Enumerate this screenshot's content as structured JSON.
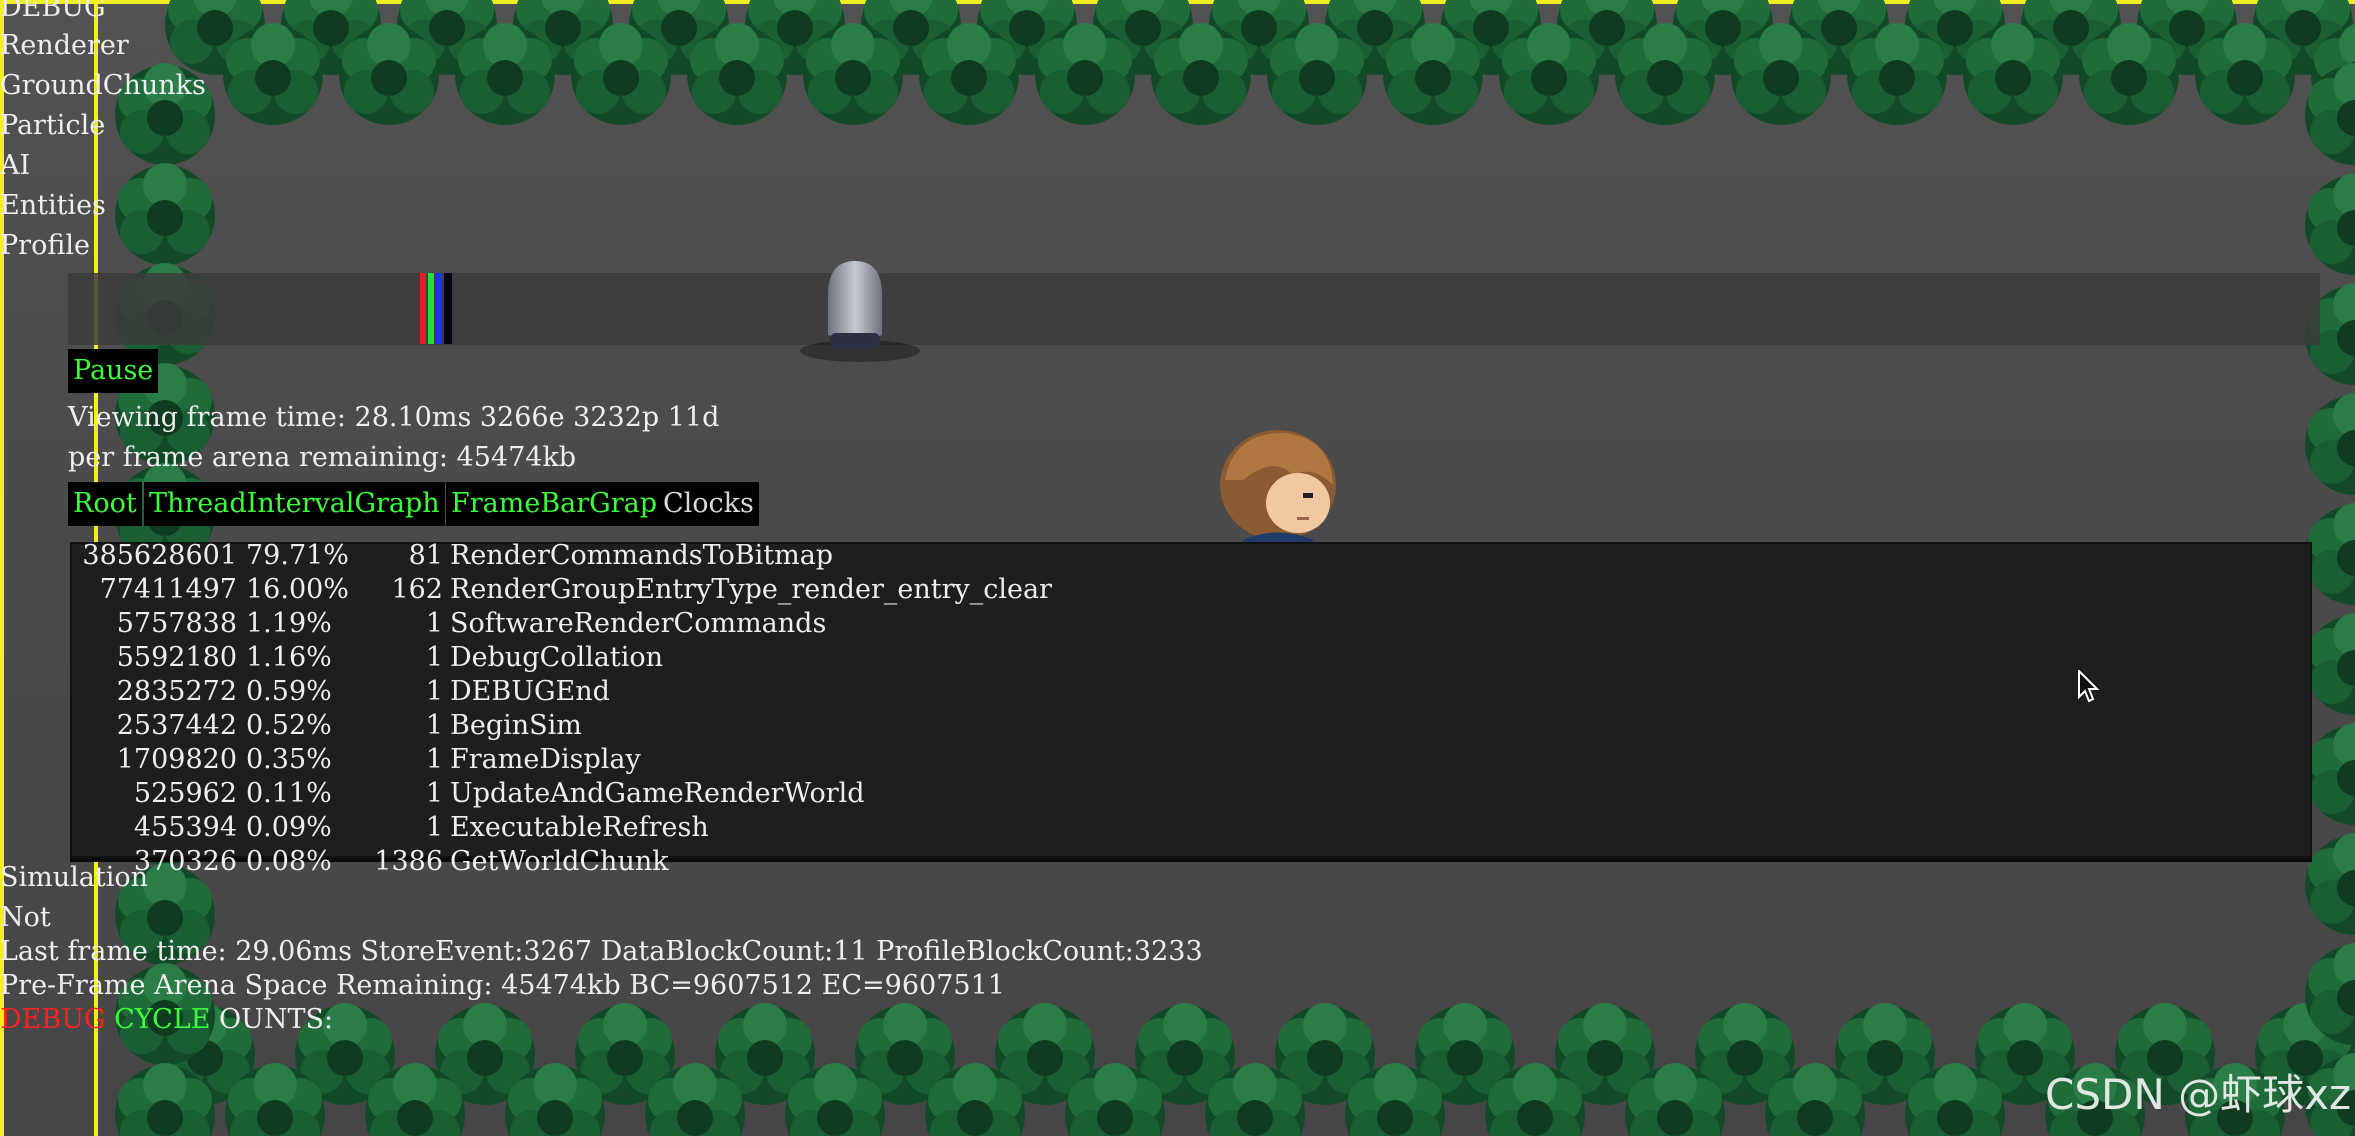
{
  "debug_menu": {
    "items": [
      "DEBUG",
      "Renderer",
      "GroundChunks",
      "Particle",
      "AI",
      "Entities",
      "Profile"
    ]
  },
  "profile": {
    "pause_label": "Pause",
    "frame_info": "Viewing frame time: 28.10ms 3266e 3232p 11d",
    "arena_info": "per frame arena remaining: 45474kb",
    "tabs": [
      {
        "label": "Root",
        "active": true
      },
      {
        "label": "ThreadIntervalGraph",
        "active": true
      },
      {
        "label": "FrameBarGraph",
        "active": true
      },
      {
        "label": "Clocks",
        "active": false
      }
    ],
    "rows": [
      {
        "cycles": "385628601",
        "pct": "79.71%",
        "count": "81",
        "name": "RenderCommandsToBitmap"
      },
      {
        "cycles": "77411497",
        "pct": "16.00%",
        "count": "162",
        "name": "RenderGroupEntryType_render_entry_clear"
      },
      {
        "cycles": "5757838",
        "pct": "1.19%",
        "count": "1",
        "name": "SoftwareRenderCommands"
      },
      {
        "cycles": "5592180",
        "pct": "1.16%",
        "count": "1",
        "name": "DebugCollation"
      },
      {
        "cycles": "2835272",
        "pct": "0.59%",
        "count": "1",
        "name": "DEBUGEnd"
      },
      {
        "cycles": "2537442",
        "pct": "0.52%",
        "count": "1",
        "name": "BeginSim"
      },
      {
        "cycles": "1709820",
        "pct": "0.35%",
        "count": "1",
        "name": "FrameDisplay"
      },
      {
        "cycles": "525962",
        "pct": "0.11%",
        "count": "1",
        "name": "UpdateAndGameRenderWorld"
      },
      {
        "cycles": "455394",
        "pct": "0.09%",
        "count": "1",
        "name": "ExecutableRefresh"
      },
      {
        "cycles": "370326",
        "pct": "0.08%",
        "count": "1386",
        "name": "GetWorldChunk"
      }
    ]
  },
  "footer": {
    "simulation": "Simulation",
    "not": "Not",
    "last_frame": "Last frame time: 29.06ms StoreEvent:3267 DataBlockCount:11 ProfileBlockCount:3233",
    "arena": "Pre-Frame Arena Space Remaining: 45474kb BC=9607512 EC=9607511",
    "cycle_red": "DEBUG",
    "cycle_green": "CYCLE",
    "cycle_white": "OUNTS:"
  },
  "watermark": "CSDN @虾球xz",
  "colors": {
    "accent_green": "#3aff3a",
    "cycle_red": "#ff2020",
    "border_yellow": "#f2ee24",
    "tree_green": "#1f6b3a"
  },
  "icons": [
    "pine-tree-icon",
    "mouse-cursor-icon"
  ]
}
